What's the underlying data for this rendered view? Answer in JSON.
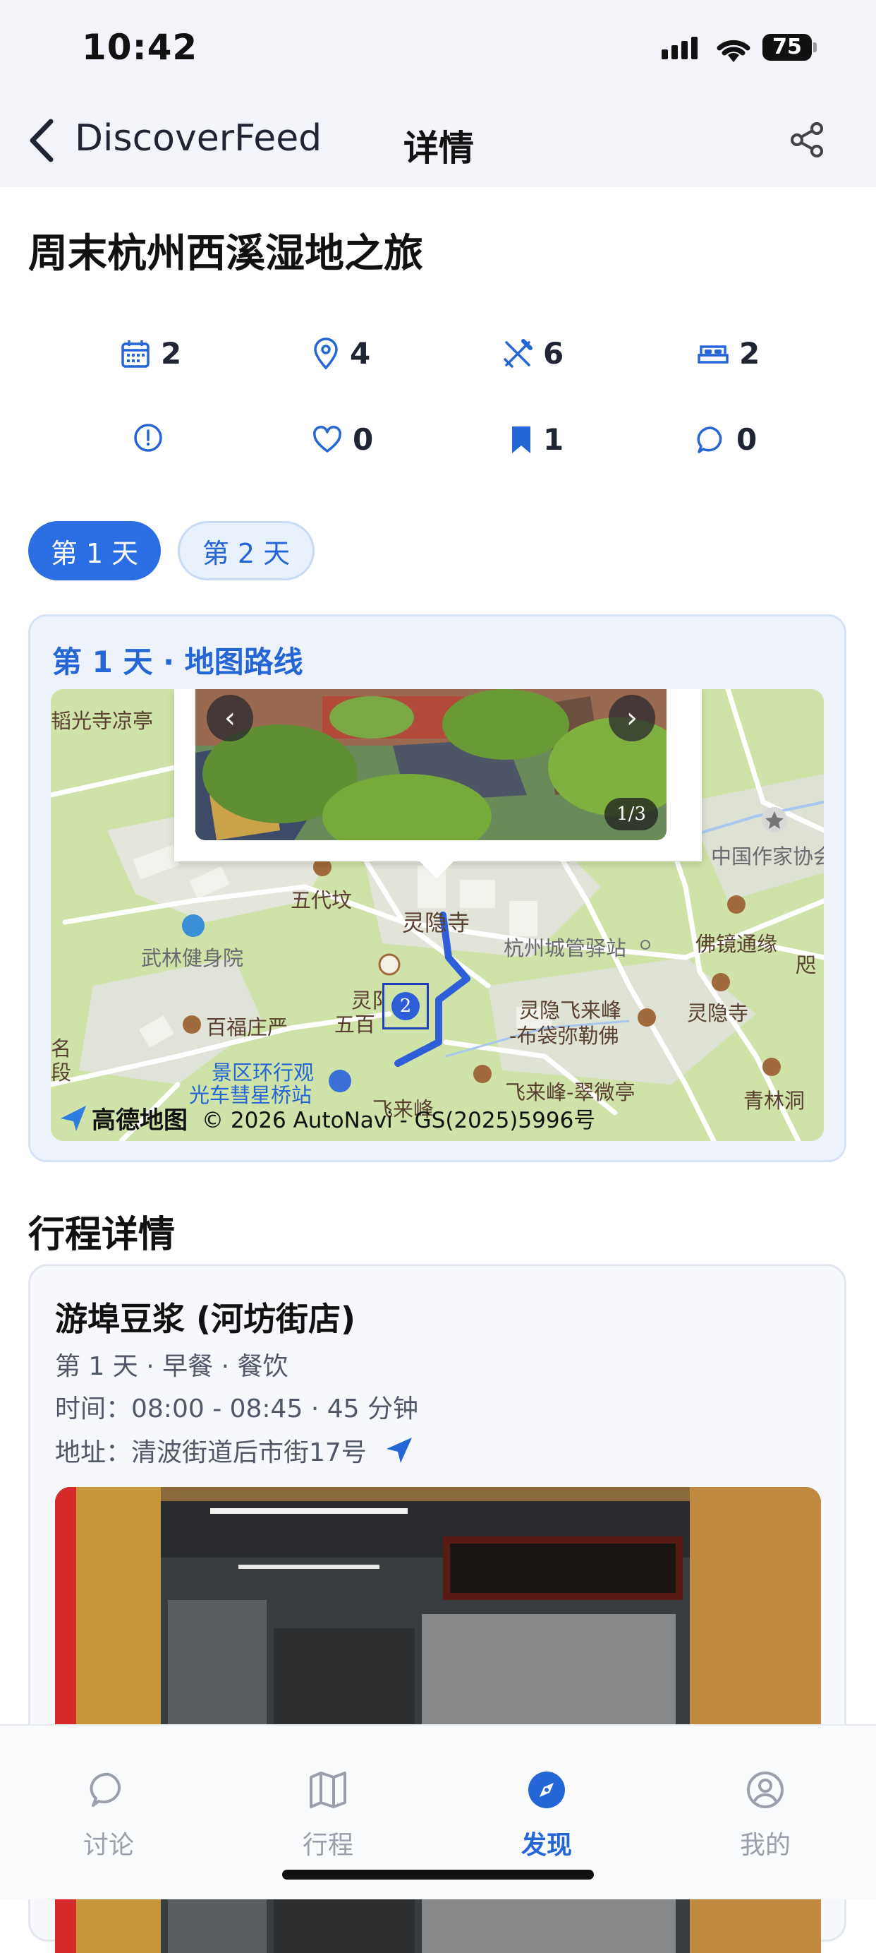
{
  "status_bar": {
    "time": "10:42",
    "battery": "75"
  },
  "nav": {
    "back_label": "DiscoverFeed",
    "title": "详情"
  },
  "trip": {
    "title": "周末杭州西溪湿地之旅",
    "stats": [
      {
        "icon": "calendar-icon",
        "value": "2"
      },
      {
        "icon": "location-pin-icon",
        "value": "4"
      },
      {
        "icon": "utensils-icon",
        "value": "6"
      },
      {
        "icon": "bed-icon",
        "value": "2"
      },
      {
        "icon": "alert-circle-icon",
        "value": ""
      },
      {
        "icon": "heart-icon",
        "value": "0"
      },
      {
        "icon": "bookmark-icon",
        "value": "1"
      },
      {
        "icon": "comment-icon",
        "value": "0"
      }
    ]
  },
  "day_tabs": [
    {
      "label": "第 1 天",
      "active": true
    },
    {
      "label": "第 2 天",
      "active": false
    }
  ],
  "map_card": {
    "title": "第 1 天 · 地图路线",
    "photo_counter": "1/3",
    "prev_glyph": "‹",
    "next_glyph": "›",
    "marker_number": "2",
    "labels": {
      "l1": "韬光寺凉亭",
      "l2": "中国作家协会",
      "l3": "五代坟",
      "l4": "灵隐寺",
      "l5": "杭州城管驿站",
      "l6": "佛镜通缘",
      "l7": "武林健身院",
      "l8": "灵隐寺",
      "l9": "百福庄严",
      "l10": "灵隐飞来峰",
      "l11": "-布袋弥勒佛",
      "l12": "灵阝",
      "l13": "五百",
      "l14": "景区环行观",
      "l15": "光车彗星桥站",
      "l16": "飞来峰-翠微亭",
      "l17": "青林洞",
      "l18": "名",
      "l19": "段",
      "l20": "飞来峰",
      "l21": "咫"
    },
    "attribution_logo": "高德地图",
    "attribution_text": "© 2026 AutoNavi - GS(2025)5996号"
  },
  "itinerary": {
    "section_title": "行程详情",
    "item": {
      "name": "游埠豆浆 (河坊街店)",
      "meta": "第 1 天 · 早餐 · 餐饮",
      "time": "时间：08:00 - 08:45 · 45 分钟",
      "address": "地址：清波街道后市街17号"
    }
  },
  "tab_bar": [
    {
      "label": "讨论",
      "icon": "chat-bubble-icon",
      "active": false
    },
    {
      "label": "行程",
      "icon": "map-icon",
      "active": false
    },
    {
      "label": "发现",
      "icon": "compass-icon",
      "active": true
    },
    {
      "label": "我的",
      "icon": "user-circle-icon",
      "active": false
    }
  ],
  "colors": {
    "accent": "#2566d6",
    "accent_fill": "#2b6ee3",
    "route": "#2f5fd8"
  }
}
